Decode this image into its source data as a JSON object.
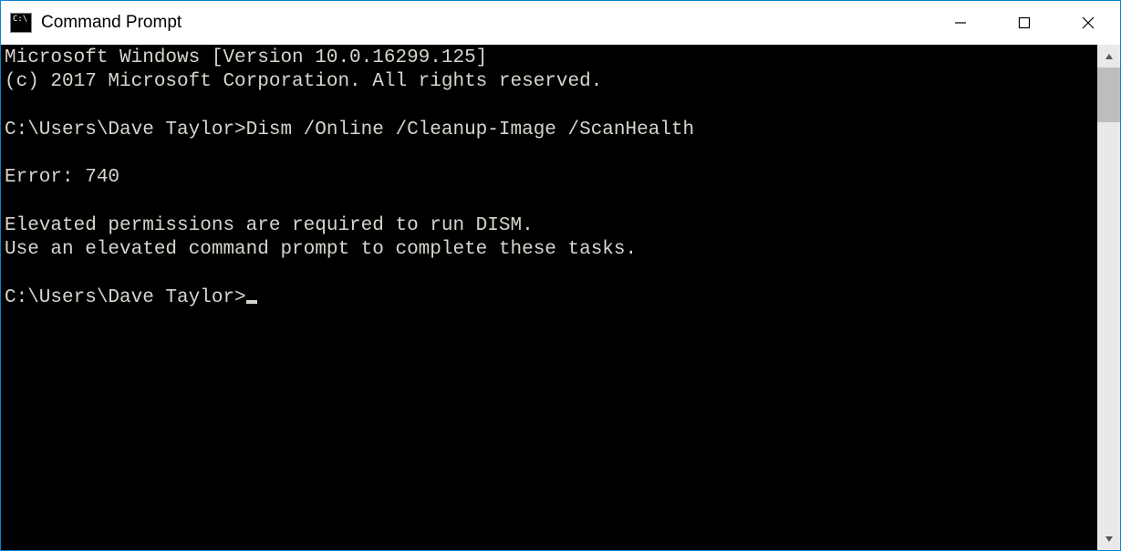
{
  "window": {
    "title": "Command Prompt"
  },
  "terminal": {
    "lines": [
      "Microsoft Windows [Version 10.0.16299.125]",
      "(c) 2017 Microsoft Corporation. All rights reserved.",
      "",
      "C:\\Users\\Dave Taylor>Dism /Online /Cleanup-Image /ScanHealth",
      "",
      "Error: 740",
      "",
      "Elevated permissions are required to run DISM.",
      "Use an elevated command prompt to complete these tasks.",
      ""
    ],
    "prompt": "C:\\Users\\Dave Taylor>"
  }
}
